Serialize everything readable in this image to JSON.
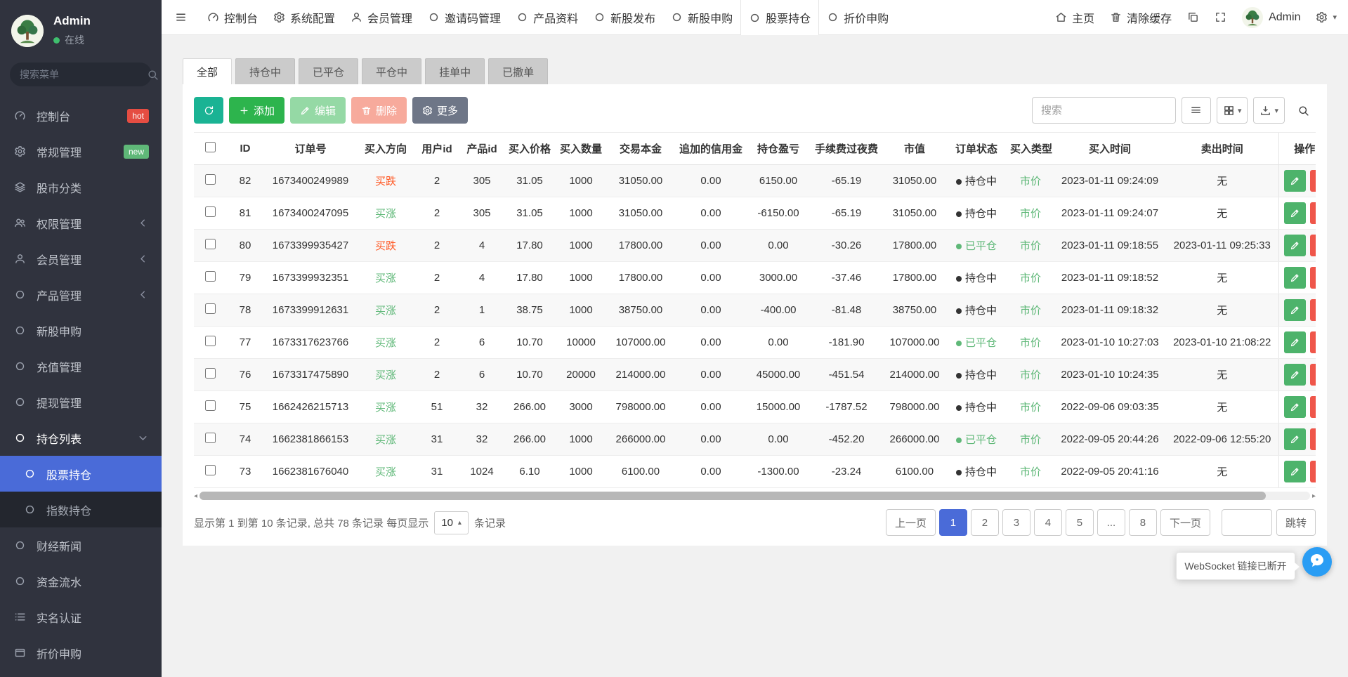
{
  "colors": {
    "accent": "#4a6bd8",
    "green": "#5fb878",
    "red": "#ff5722",
    "teal": "#1ab394",
    "add_green": "#2db44d"
  },
  "navbar": {
    "tabs": [
      {
        "label": "控制台",
        "icon": "gauge"
      },
      {
        "label": "系统配置",
        "icon": "gear"
      },
      {
        "label": "会员管理",
        "icon": "user"
      },
      {
        "label": "邀请码管理",
        "icon": "circle"
      },
      {
        "label": "产品资料",
        "icon": "circle"
      },
      {
        "label": "新股发布",
        "icon": "circle"
      },
      {
        "label": "新股申购",
        "icon": "circle"
      },
      {
        "label": "股票持仓",
        "icon": "circle",
        "active": true
      },
      {
        "label": "折价申购",
        "icon": "circle"
      }
    ],
    "right": {
      "home_label": "主页",
      "clear_cache_label": "清除缓存",
      "username": "Admin"
    }
  },
  "sidebar": {
    "username": "Admin",
    "status": "在线",
    "search_placeholder": "搜索菜单",
    "items": [
      {
        "label": "控制台",
        "icon": "gauge",
        "badge": "hot"
      },
      {
        "label": "常规管理",
        "icon": "gear",
        "badge": "new"
      },
      {
        "label": "股市分类",
        "icon": "layers"
      },
      {
        "label": "权限管理",
        "icon": "users",
        "arrow": "left"
      },
      {
        "label": "会员管理",
        "icon": "user",
        "arrow": "left"
      },
      {
        "label": "产品管理",
        "icon": "circle",
        "arrow": "left"
      },
      {
        "label": "新股申购",
        "icon": "circle"
      },
      {
        "label": "充值管理",
        "icon": "circle"
      },
      {
        "label": "提现管理",
        "icon": "circle"
      },
      {
        "label": "持仓列表",
        "icon": "circle",
        "arrow": "down",
        "open": true
      },
      {
        "label": "股票持仓",
        "icon": "circle",
        "sub": true,
        "active": true
      },
      {
        "label": "指数持仓",
        "icon": "circle",
        "sub": true
      },
      {
        "label": "财经新闻",
        "icon": "circle"
      },
      {
        "label": "资金流水",
        "icon": "circle"
      },
      {
        "label": "实名认证",
        "icon": "list"
      },
      {
        "label": "折价申购",
        "icon": "window"
      }
    ]
  },
  "filter_tabs": [
    {
      "label": "全部",
      "active": true
    },
    {
      "label": "持仓中"
    },
    {
      "label": "已平仓"
    },
    {
      "label": "平仓中"
    },
    {
      "label": "挂单中"
    },
    {
      "label": "已撤单"
    }
  ],
  "toolbar": {
    "add_label": "添加",
    "edit_label": "编辑",
    "delete_label": "删除",
    "more_label": "更多",
    "search_placeholder": "搜索"
  },
  "table": {
    "columns": [
      "ID",
      "订单号",
      "买入方向",
      "用户id",
      "产品id",
      "买入价格",
      "买入数量",
      "交易本金",
      "追加的信用金",
      "持仓盈亏",
      "手续费过夜费",
      "市值",
      "订单状态",
      "买入类型",
      "买入时间",
      "卖出时间",
      "操作"
    ],
    "rows": [
      {
        "id": "82",
        "order_no": "1673400249989",
        "direction": "买跌",
        "user_id": "2",
        "product_id": "305",
        "buy_price": "31.05",
        "buy_qty": "1000",
        "principal": "31050.00",
        "extra_credit": "0.00",
        "pnl": "6150.00",
        "fee": "-65.19",
        "market_value": "31050.00",
        "status": "持仓中",
        "buy_type": "市价",
        "buy_time": "2023-01-11 09:24:09",
        "sell_time": "无"
      },
      {
        "id": "81",
        "order_no": "1673400247095",
        "direction": "买涨",
        "user_id": "2",
        "product_id": "305",
        "buy_price": "31.05",
        "buy_qty": "1000",
        "principal": "31050.00",
        "extra_credit": "0.00",
        "pnl": "-6150.00",
        "fee": "-65.19",
        "market_value": "31050.00",
        "status": "持仓中",
        "buy_type": "市价",
        "buy_time": "2023-01-11 09:24:07",
        "sell_time": "无"
      },
      {
        "id": "80",
        "order_no": "1673399935427",
        "direction": "买跌",
        "user_id": "2",
        "product_id": "4",
        "buy_price": "17.80",
        "buy_qty": "1000",
        "principal": "17800.00",
        "extra_credit": "0.00",
        "pnl": "0.00",
        "fee": "-30.26",
        "market_value": "17800.00",
        "status": "已平仓",
        "buy_type": "市价",
        "buy_time": "2023-01-11 09:18:55",
        "sell_time": "2023-01-11 09:25:33"
      },
      {
        "id": "79",
        "order_no": "1673399932351",
        "direction": "买涨",
        "user_id": "2",
        "product_id": "4",
        "buy_price": "17.80",
        "buy_qty": "1000",
        "principal": "17800.00",
        "extra_credit": "0.00",
        "pnl": "3000.00",
        "fee": "-37.46",
        "market_value": "17800.00",
        "status": "持仓中",
        "buy_type": "市价",
        "buy_time": "2023-01-11 09:18:52",
        "sell_time": "无"
      },
      {
        "id": "78",
        "order_no": "1673399912631",
        "direction": "买涨",
        "user_id": "2",
        "product_id": "1",
        "buy_price": "38.75",
        "buy_qty": "1000",
        "principal": "38750.00",
        "extra_credit": "0.00",
        "pnl": "-400.00",
        "fee": "-81.48",
        "market_value": "38750.00",
        "status": "持仓中",
        "buy_type": "市价",
        "buy_time": "2023-01-11 09:18:32",
        "sell_time": "无"
      },
      {
        "id": "77",
        "order_no": "1673317623766",
        "direction": "买涨",
        "user_id": "2",
        "product_id": "6",
        "buy_price": "10.70",
        "buy_qty": "10000",
        "principal": "107000.00",
        "extra_credit": "0.00",
        "pnl": "0.00",
        "fee": "-181.90",
        "market_value": "107000.00",
        "status": "已平仓",
        "buy_type": "市价",
        "buy_time": "2023-01-10 10:27:03",
        "sell_time": "2023-01-10 21:08:22"
      },
      {
        "id": "76",
        "order_no": "1673317475890",
        "direction": "买涨",
        "user_id": "2",
        "product_id": "6",
        "buy_price": "10.70",
        "buy_qty": "20000",
        "principal": "214000.00",
        "extra_credit": "0.00",
        "pnl": "45000.00",
        "fee": "-451.54",
        "market_value": "214000.00",
        "status": "持仓中",
        "buy_type": "市价",
        "buy_time": "2023-01-10 10:24:35",
        "sell_time": "无"
      },
      {
        "id": "75",
        "order_no": "1662426215713",
        "direction": "买涨",
        "user_id": "51",
        "product_id": "32",
        "buy_price": "266.00",
        "buy_qty": "3000",
        "principal": "798000.00",
        "extra_credit": "0.00",
        "pnl": "15000.00",
        "fee": "-1787.52",
        "market_value": "798000.00",
        "status": "持仓中",
        "buy_type": "市价",
        "buy_time": "2022-09-06 09:03:35",
        "sell_time": "无"
      },
      {
        "id": "74",
        "order_no": "1662381866153",
        "direction": "买涨",
        "user_id": "31",
        "product_id": "32",
        "buy_price": "266.00",
        "buy_qty": "1000",
        "principal": "266000.00",
        "extra_credit": "0.00",
        "pnl": "0.00",
        "fee": "-452.20",
        "market_value": "266000.00",
        "status": "已平仓",
        "buy_type": "市价",
        "buy_time": "2022-09-05 20:44:26",
        "sell_time": "2022-09-06 12:55:20"
      },
      {
        "id": "73",
        "order_no": "1662381676040",
        "direction": "买涨",
        "user_id": "31",
        "product_id": "1024",
        "buy_price": "6.10",
        "buy_qty": "1000",
        "principal": "6100.00",
        "extra_credit": "0.00",
        "pnl": "-1300.00",
        "fee": "-23.24",
        "market_value": "6100.00",
        "status": "持仓中",
        "buy_type": "市价",
        "buy_time": "2022-09-05 20:41:16",
        "sell_time": "无"
      }
    ]
  },
  "pagination": {
    "info_prefix": "显示第 1 到第 10 条记录, 总共 78 条记录 每页显示",
    "page_size": "10",
    "info_suffix": "条记录",
    "pages": [
      "上一页",
      "1",
      "2",
      "3",
      "4",
      "5",
      "...",
      "8",
      "下一页"
    ],
    "active_page": "1",
    "jump_label": "跳转"
  },
  "websocket_tooltip": "WebSocket 链接已断开"
}
